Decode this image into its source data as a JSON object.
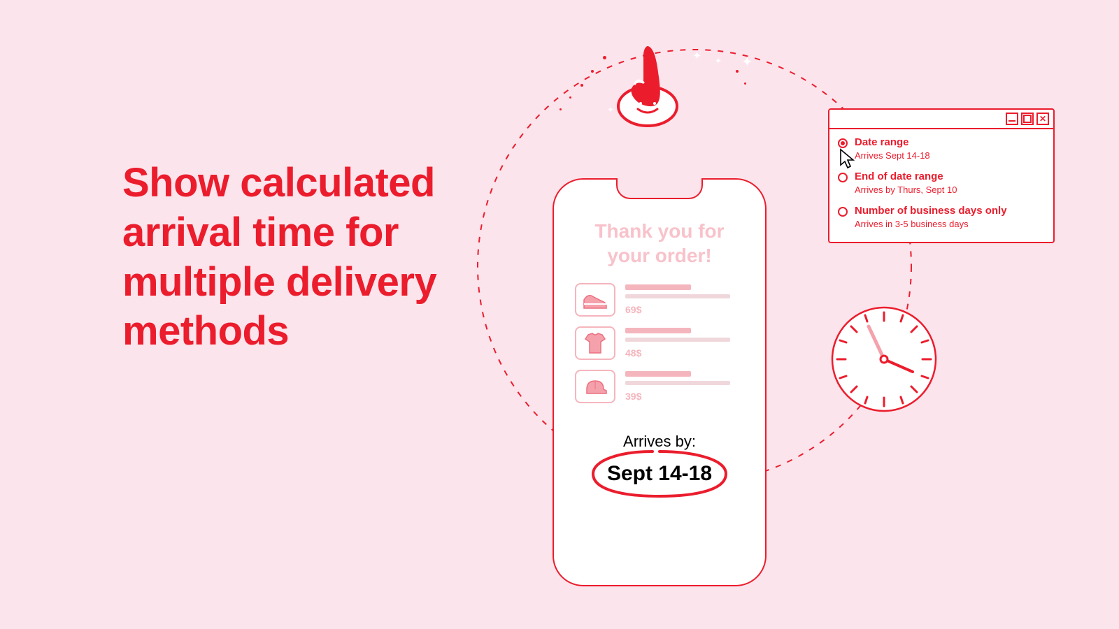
{
  "headline": "Show calculated arrival time for multiple delivery methods",
  "phone": {
    "thank_line1": "Thank you for",
    "thank_line2": "your order!",
    "items": [
      {
        "price": "69$",
        "icon": "shoe"
      },
      {
        "price": "48$",
        "icon": "tshirt"
      },
      {
        "price": "39$",
        "icon": "cap"
      }
    ],
    "arrives_label": "Arrives by:",
    "arrival_date": "Sept 14-18"
  },
  "options": [
    {
      "title": "Date range",
      "sub": "Arrives Sept 14-18",
      "selected": true
    },
    {
      "title": "End of date range",
      "sub": "Arrives by Thurs, Sept 10",
      "selected": false
    },
    {
      "title": "Number of business days only",
      "sub": "Arrives in 3-5 business days",
      "selected": false
    }
  ],
  "colors": {
    "accent": "#eb1d2d",
    "bg": "#fce4ec",
    "faded": "#f8c2ca"
  }
}
